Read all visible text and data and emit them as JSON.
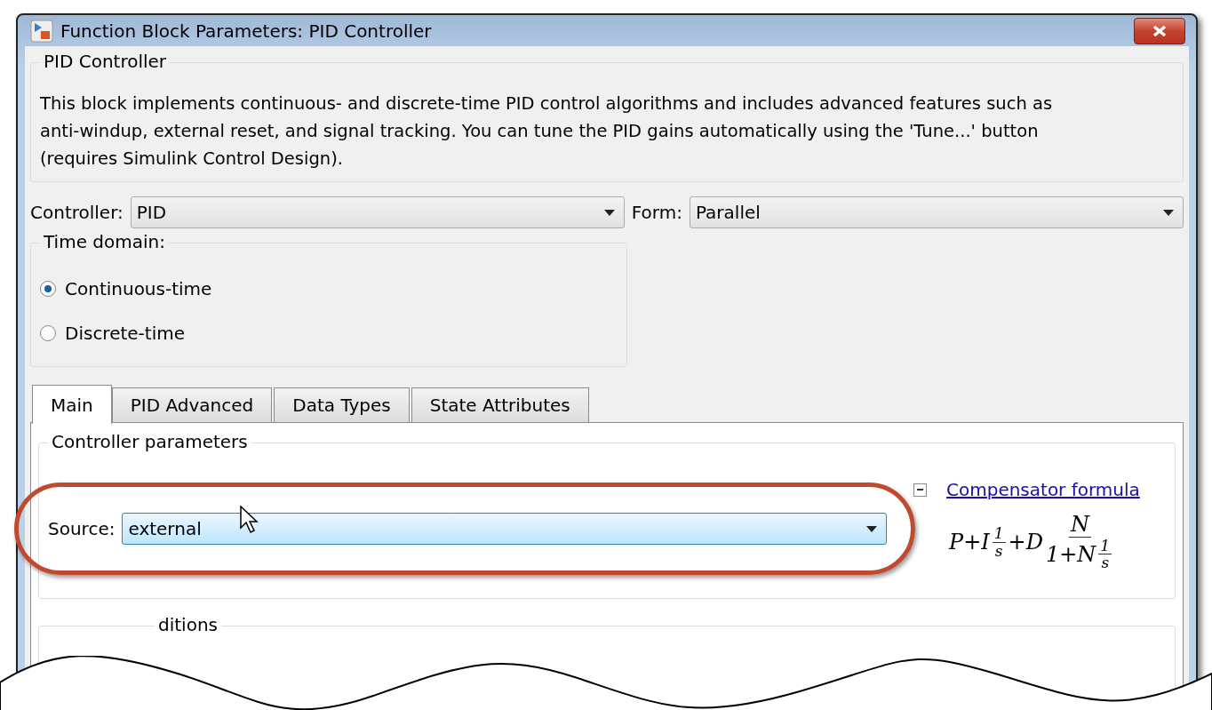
{
  "window": {
    "title": "Function Block Parameters: PID Controller"
  },
  "description": {
    "title": "PID Controller",
    "text": "This block implements continuous- and discrete-time PID control algorithms and includes advanced features such as anti-windup, external reset, and signal tracking. You can tune the PID gains automatically using the 'Tune...' button (requires Simulink Control Design)."
  },
  "controller": {
    "label": "Controller:",
    "value": "PID"
  },
  "form": {
    "label": "Form:",
    "value": "Parallel"
  },
  "time_domain": {
    "title": "Time domain:",
    "options": [
      {
        "label": "Continuous-time",
        "selected": true
      },
      {
        "label": "Discrete-time",
        "selected": false
      }
    ]
  },
  "tabs": [
    {
      "label": "Main",
      "selected": true
    },
    {
      "label": "PID Advanced",
      "selected": false
    },
    {
      "label": "Data Types",
      "selected": false
    },
    {
      "label": "State Attributes",
      "selected": false
    }
  ],
  "controller_parameters": {
    "title": "Controller parameters",
    "source": {
      "label": "Source:",
      "value": "external"
    },
    "formula_link": {
      "label": "Compensator formula",
      "expanded": true
    },
    "formula": [
      {
        "kind": "text",
        "text": "P+I"
      },
      {
        "kind": "frac",
        "num": "1",
        "den": "s"
      },
      {
        "kind": "text",
        "text": "+D"
      },
      {
        "kind": "bigfrac",
        "num": "N",
        "den_text": "1+N",
        "den_frac": {
          "num": "1",
          "den": "s"
        }
      }
    ]
  },
  "next_group": {
    "title": "ditions"
  }
}
